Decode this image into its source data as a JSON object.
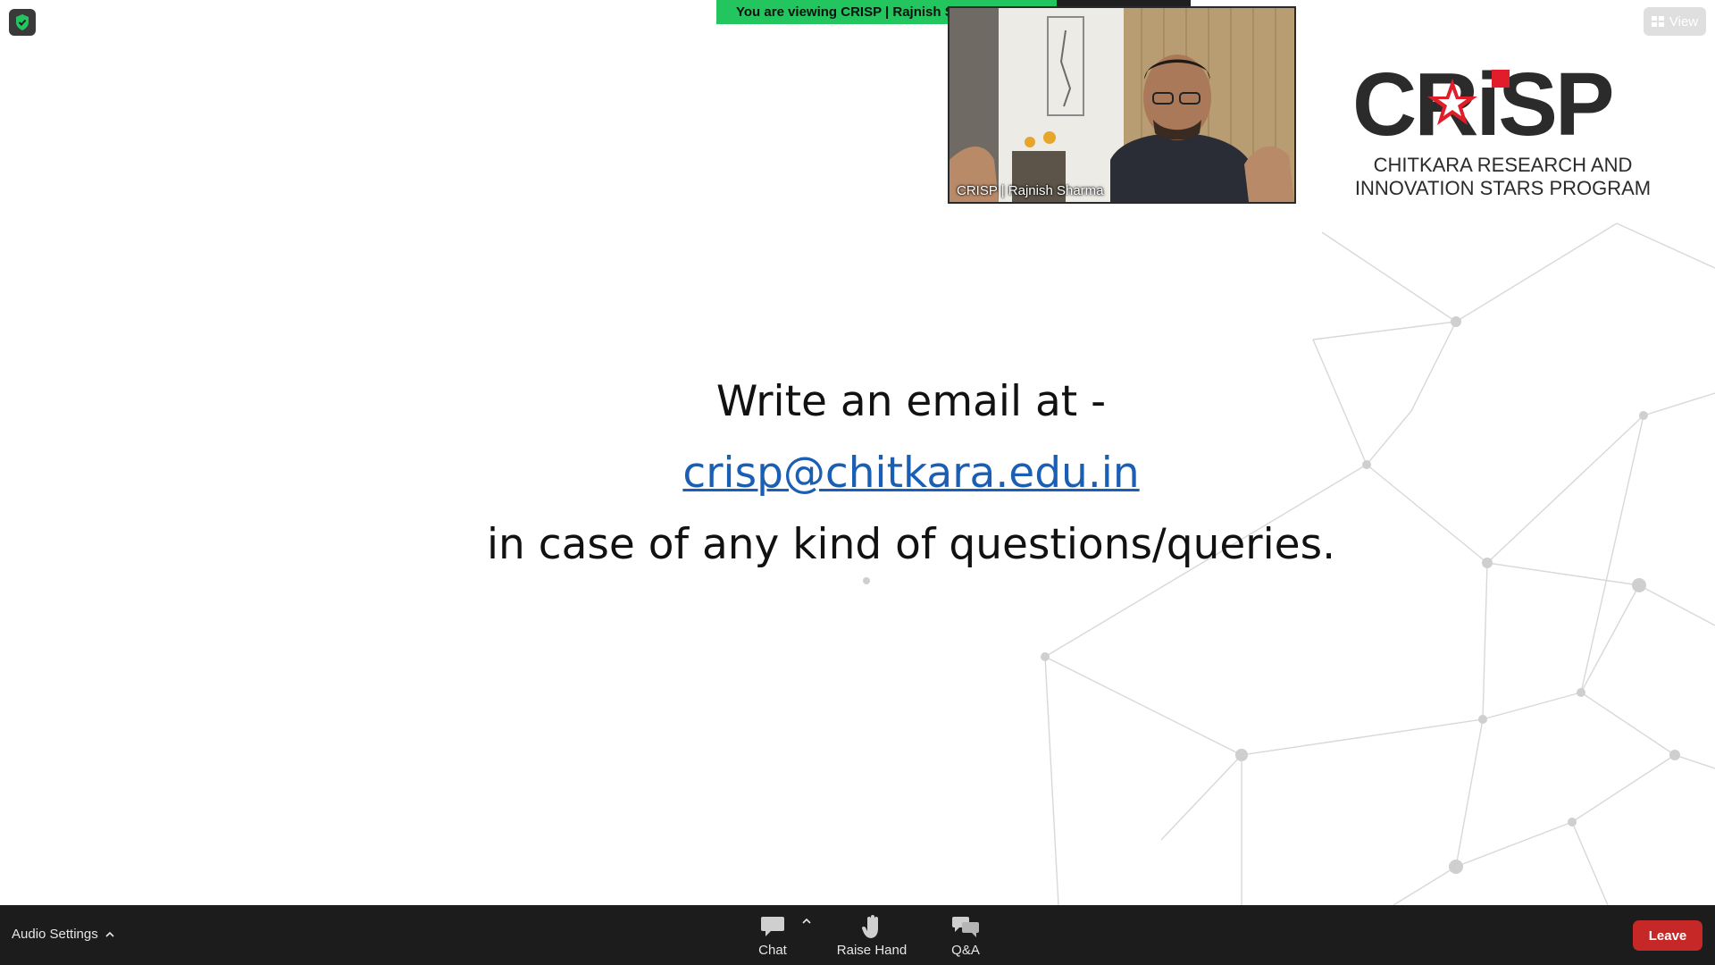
{
  "banner": {
    "viewing_text": "You are viewing CRISP | Rajnish Sharma's screen"
  },
  "view_button": {
    "label": "View"
  },
  "video": {
    "participant_name": "CRISP | Rajnish Sharma"
  },
  "logo": {
    "wordmark": "CRiSP",
    "subtitle_line1": "CHITKARA RESEARCH AND",
    "subtitle_line2": "INNOVATION STARS PROGRAM"
  },
  "slide": {
    "line1": "Write an email at -",
    "email": "crisp@chitkara.edu.in",
    "line3": "in case of any kind of questions/queries."
  },
  "toolbar": {
    "audio_settings": "Audio Settings",
    "chat": "Chat",
    "raise_hand": "Raise Hand",
    "qa": "Q&A",
    "leave": "Leave"
  },
  "colors": {
    "banner_green": "#22c55e",
    "link_blue": "#1a5fb4",
    "leave_red": "#c62828",
    "toolbar_bg": "#1c1c1c",
    "logo_star_red": "#e11d2a"
  },
  "icons": [
    "shield-check-icon",
    "grid-icon",
    "chat-bubble-icon",
    "caret-up-icon",
    "hand-icon",
    "qa-bubbles-icon"
  ]
}
